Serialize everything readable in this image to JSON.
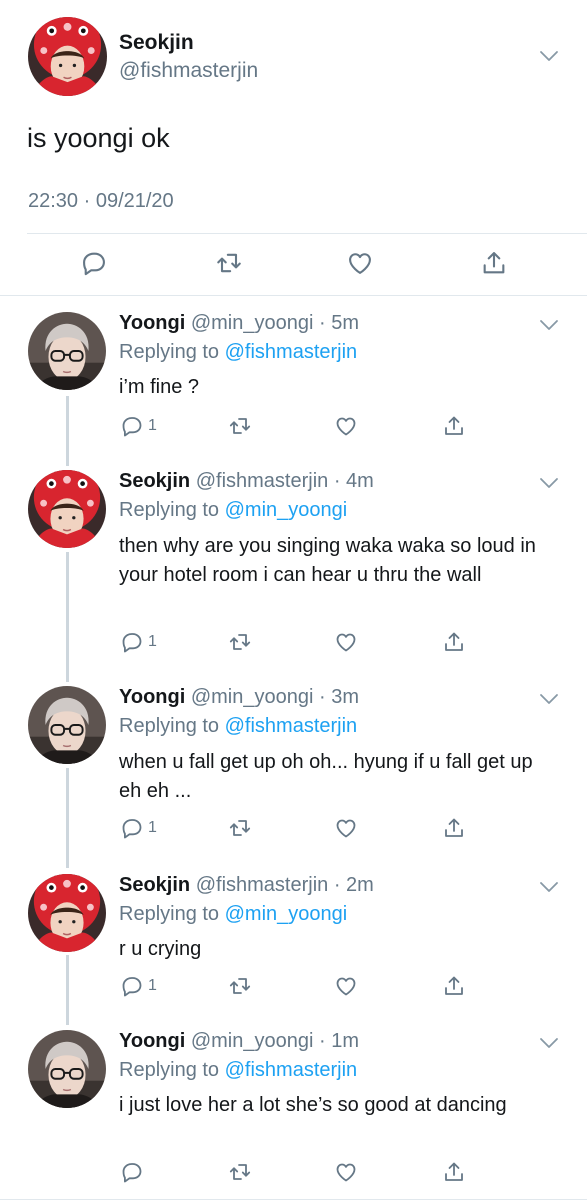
{
  "main_tweet": {
    "name": "Seokjin",
    "handle": "@fishmasterjin",
    "text": "is yoongi ok",
    "timestamp": "22:30 · 09/21/20",
    "avatar": "red-hood-avatar"
  },
  "replies": [
    {
      "name": "Yoongi",
      "handle_time": "@min_yoongi · 5m",
      "replying_prefix": "Replying to",
      "replying_to": "@fishmasterjin",
      "text": "i’m fine ?",
      "reply_count": "1",
      "avatar": "glasses-avatar"
    },
    {
      "name": "Seokjin",
      "handle_time": "@fishmasterjin · 4m",
      "replying_prefix": "Replying to",
      "replying_to": "@min_yoongi",
      "text": "then why are you singing waka waka so loud in your hotel room i can hear u thru the wall",
      "reply_count": "1",
      "avatar": "red-hood-avatar"
    },
    {
      "name": "Yoongi",
      "handle_time": "@min_yoongi · 3m",
      "replying_prefix": "Replying to",
      "replying_to": "@fishmasterjin",
      "text": "when u fall get up oh oh... hyung if u fall get up eh eh ...",
      "reply_count": "1",
      "avatar": "glasses-avatar"
    },
    {
      "name": "Seokjin",
      "handle_time": "@fishmasterjin · 2m",
      "replying_prefix": "Replying to",
      "replying_to": "@min_yoongi",
      "text": "r u crying",
      "reply_count": "1",
      "avatar": "red-hood-avatar"
    },
    {
      "name": "Yoongi",
      "handle_time": "@min_yoongi · 1m",
      "replying_prefix": "Replying to",
      "replying_to": "@fishmasterjin",
      "text": "i just love her a lot she’s so good at dancing",
      "reply_count": "",
      "avatar": "glasses-avatar"
    }
  ],
  "colors": {
    "text": "#14171a",
    "secondary": "#657786",
    "link": "#1da1f2",
    "divider": "#e1e8ed",
    "thread_line": "#cdd6dd"
  }
}
